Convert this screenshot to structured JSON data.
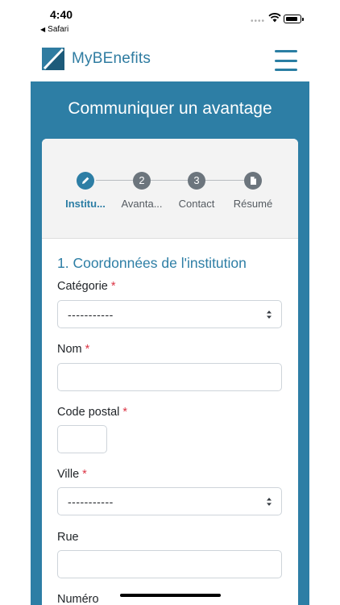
{
  "status_bar": {
    "time": "4:40",
    "back_label": "Safari",
    "icons": [
      "wifi-icon",
      "battery-icon"
    ]
  },
  "header": {
    "brand": "MyBEnefits",
    "brand_color": "#2f7ca1",
    "menu_icon": "hamburger-icon"
  },
  "page": {
    "title": "Communiquer un avantage",
    "panel_color": "#2d7ea5"
  },
  "stepper": {
    "steps": [
      {
        "marker": "",
        "icon": "pencil-icon",
        "label": "Institu...",
        "active": true
      },
      {
        "marker": "2",
        "label": "Avanta...",
        "active": false
      },
      {
        "marker": "3",
        "label": "Contact",
        "active": false
      },
      {
        "marker": "",
        "icon": "document-icon",
        "label": "Résumé",
        "active": false
      }
    ]
  },
  "form": {
    "section_title": "1. Coordonnées de l'institution",
    "required_marker": "*",
    "fields": {
      "categorie": {
        "label": "Catégorie",
        "value": "-----------"
      },
      "nom": {
        "label": "Nom",
        "value": ""
      },
      "code_postal": {
        "label": "Code postal",
        "value": ""
      },
      "ville": {
        "label": "Ville",
        "value": "-----------"
      },
      "rue": {
        "label": "Rue",
        "value": ""
      },
      "numero": {
        "label": "Numéro"
      }
    }
  }
}
